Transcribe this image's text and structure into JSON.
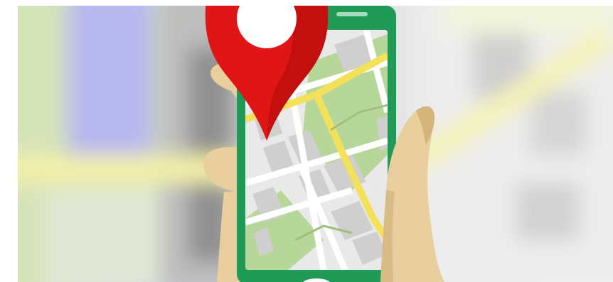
{
  "image": {
    "subject": "hand-holding-smartphone-with-map-and-location-pin",
    "colors": {
      "page_background": "#ffffff",
      "phone_frame": "#1f9a57",
      "map_background": "#e9e9e9",
      "map_blocks": "#cfcfcf",
      "map_roads": "#ffffff",
      "map_main_road": "#f4e15a",
      "map_park": "#b7d79a",
      "location_pin": "#e01515",
      "pin_center": "#ffffff",
      "hand_skin": "#e8cf9d",
      "hand_shadow": "#d5b57a"
    },
    "icons": [
      "location-pin-icon",
      "phone-home-button-icon"
    ]
  }
}
